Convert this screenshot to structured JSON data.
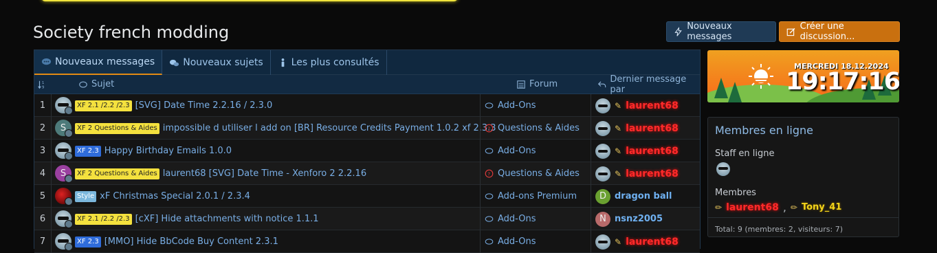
{
  "page": {
    "title": "Society french modding"
  },
  "actions": {
    "new_messages": "Nouveaux messages",
    "create": "Créer une discussion..."
  },
  "tabs": [
    {
      "label": "Nouveaux messages"
    },
    {
      "label": "Nouveaux sujets"
    },
    {
      "label": "Les plus consultés"
    }
  ],
  "columns": {
    "subject": "Sujet",
    "forum": "Forum",
    "last": "Dernier message par"
  },
  "rows": [
    {
      "num": "1",
      "prefix": "XF 2.1 /2.2 /2.3",
      "prefix_color": "yellow",
      "title": "[SVG] Date Time 2.2.16 / 2.3.0",
      "forum": "Add-Ons",
      "forum_icon": "comments-icon",
      "user": "laurent68",
      "user_style": "red"
    },
    {
      "num": "2",
      "prefix": "XF 2 Questions & Aides",
      "prefix_color": "yellow",
      "title": "impossible d utiliser l add on [BR] Resource Credits Payment 1.0.2 xf 2.3.3",
      "forum": "Questions & Aides",
      "forum_icon": "question-icon",
      "user": "laurent68",
      "user_style": "red",
      "avatar_letter": "S"
    },
    {
      "num": "3",
      "prefix": "XF 2.3",
      "prefix_color": "blue",
      "title": "Happy Birthday Emails 1.0.0",
      "forum": "Add-Ons",
      "forum_icon": "comments-icon",
      "user": "laurent68",
      "user_style": "red"
    },
    {
      "num": "4",
      "prefix": "XF 2 Questions & Aides",
      "prefix_color": "yellow",
      "title": "laurent68 [SVG] Date Time - Xenforo 2 2.2.16",
      "forum": "Questions & Aides",
      "forum_icon": "question-icon",
      "user": "laurent68",
      "user_style": "red",
      "avatar_letter": "S"
    },
    {
      "num": "5",
      "prefix": "Style",
      "prefix_color": "cyan",
      "title": "xF Christmas Special 2.0.1 / 2.3.4",
      "forum": "Add-ons Premium",
      "forum_icon": "comments-icon",
      "user": "dragon ball",
      "user_style": "blue",
      "user_letter": "D"
    },
    {
      "num": "6",
      "prefix": "XF 2.1 /2.2 /2.3",
      "prefix_color": "yellow",
      "title": "[cXF] Hide attachments with notice 1.1.1",
      "forum": "Add-Ons",
      "forum_icon": "comments-icon",
      "user": "nsnz2005",
      "user_style": "blue",
      "user_letter": "N"
    },
    {
      "num": "7",
      "prefix": "XF 2.3",
      "prefix_color": "blue",
      "title": "[MMO] Hide BbCode Buy Content 2.3.1",
      "forum": "Add-Ons",
      "forum_icon": "comments-icon",
      "user": "laurent68",
      "user_style": "red"
    }
  ],
  "clock": {
    "date": "MERCREDI 18.12.2024",
    "time": "19:17:16"
  },
  "online": {
    "title": "Membres en ligne",
    "staff_label": "Staff en ligne",
    "members_label": "Membres",
    "members": [
      "laurent68",
      "Tony_41"
    ],
    "footer": "Total: 9 (membres: 2, visiteurs: 7)"
  },
  "colors": {
    "accent": "#e38b14",
    "link": "#79aee5",
    "header_bg": "#10283f"
  }
}
